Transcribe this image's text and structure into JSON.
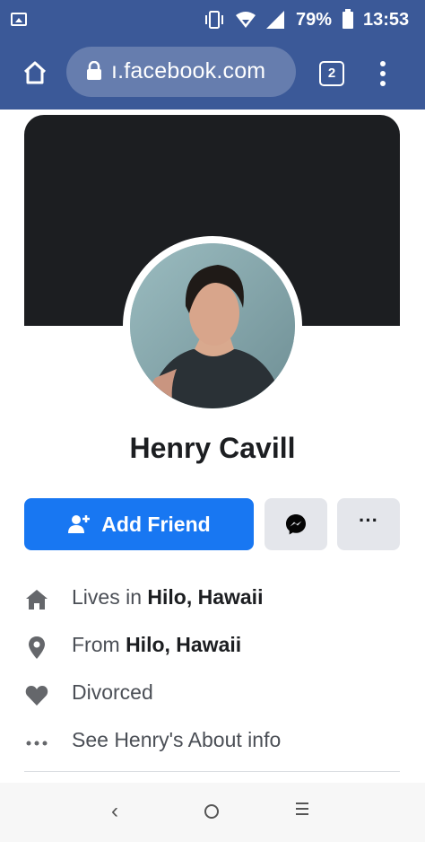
{
  "status_bar": {
    "battery_percent": "79%",
    "time": "13:53",
    "icons": [
      "image-icon",
      "vibrate-icon",
      "wifi-icon",
      "signal-icon",
      "battery-icon"
    ]
  },
  "browser": {
    "url": "ı.facebook.com",
    "tab_count": "2",
    "icons": [
      "home-icon",
      "lock-icon",
      "tabs-icon",
      "overflow-menu-icon"
    ],
    "accent_color": "#3b5998"
  },
  "profile": {
    "name": "Henry Cavill",
    "actions": {
      "add_friend": "Add Friend",
      "more": "···"
    },
    "info": [
      {
        "icon": "home-icon",
        "prefix": "Lives in ",
        "value": "Hilo, Hawaii"
      },
      {
        "icon": "location-pin-icon",
        "prefix": "From ",
        "value": "Hilo, Hawaii"
      },
      {
        "icon": "heart-icon",
        "prefix": "Divorced",
        "value": ""
      },
      {
        "icon": "more-dots-icon",
        "prefix": "See Henry's About info",
        "value": ""
      }
    ],
    "button_color": "#1877f2"
  },
  "nav_bar": {
    "back": "‹",
    "icons": [
      "back-icon",
      "home-circle-icon",
      "recent-apps-icon"
    ]
  }
}
